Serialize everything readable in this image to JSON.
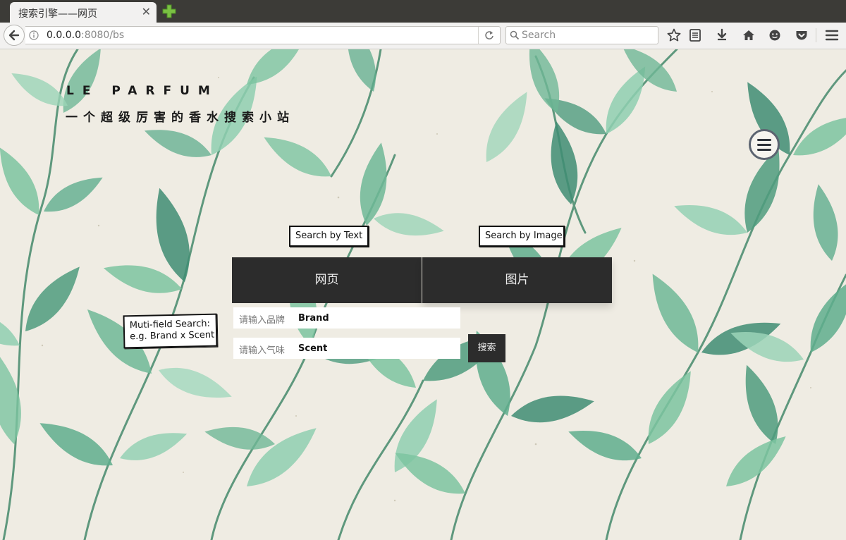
{
  "browser": {
    "tab_title": "搜索引擎——网页",
    "tab_close": "✕",
    "url_host": "0.0.0.0",
    "url_rest": ":8080/bs",
    "search_placeholder": "Search"
  },
  "header": {
    "title": "LE PARFUM",
    "subtitle": "一个超级厉害的香水搜索小站"
  },
  "annotations": {
    "search_by_text": "Search by Text",
    "search_by_image": "Search by Image",
    "multi_line1": "Muti-field Search:",
    "multi_line2": "e.g. Brand x Scent"
  },
  "search_tabs": {
    "web": "网页",
    "image": "图片"
  },
  "form": {
    "brand_label": "请输入品牌",
    "brand_value": "Brand",
    "scent_label": "请输入气味",
    "scent_value": "Scent",
    "submit": "搜索"
  },
  "colors": {
    "dark_button": "#2c2c2c",
    "leaf_green": "#7cc4a0",
    "leaf_dark": "#3f8d73",
    "background": "#efece3"
  }
}
